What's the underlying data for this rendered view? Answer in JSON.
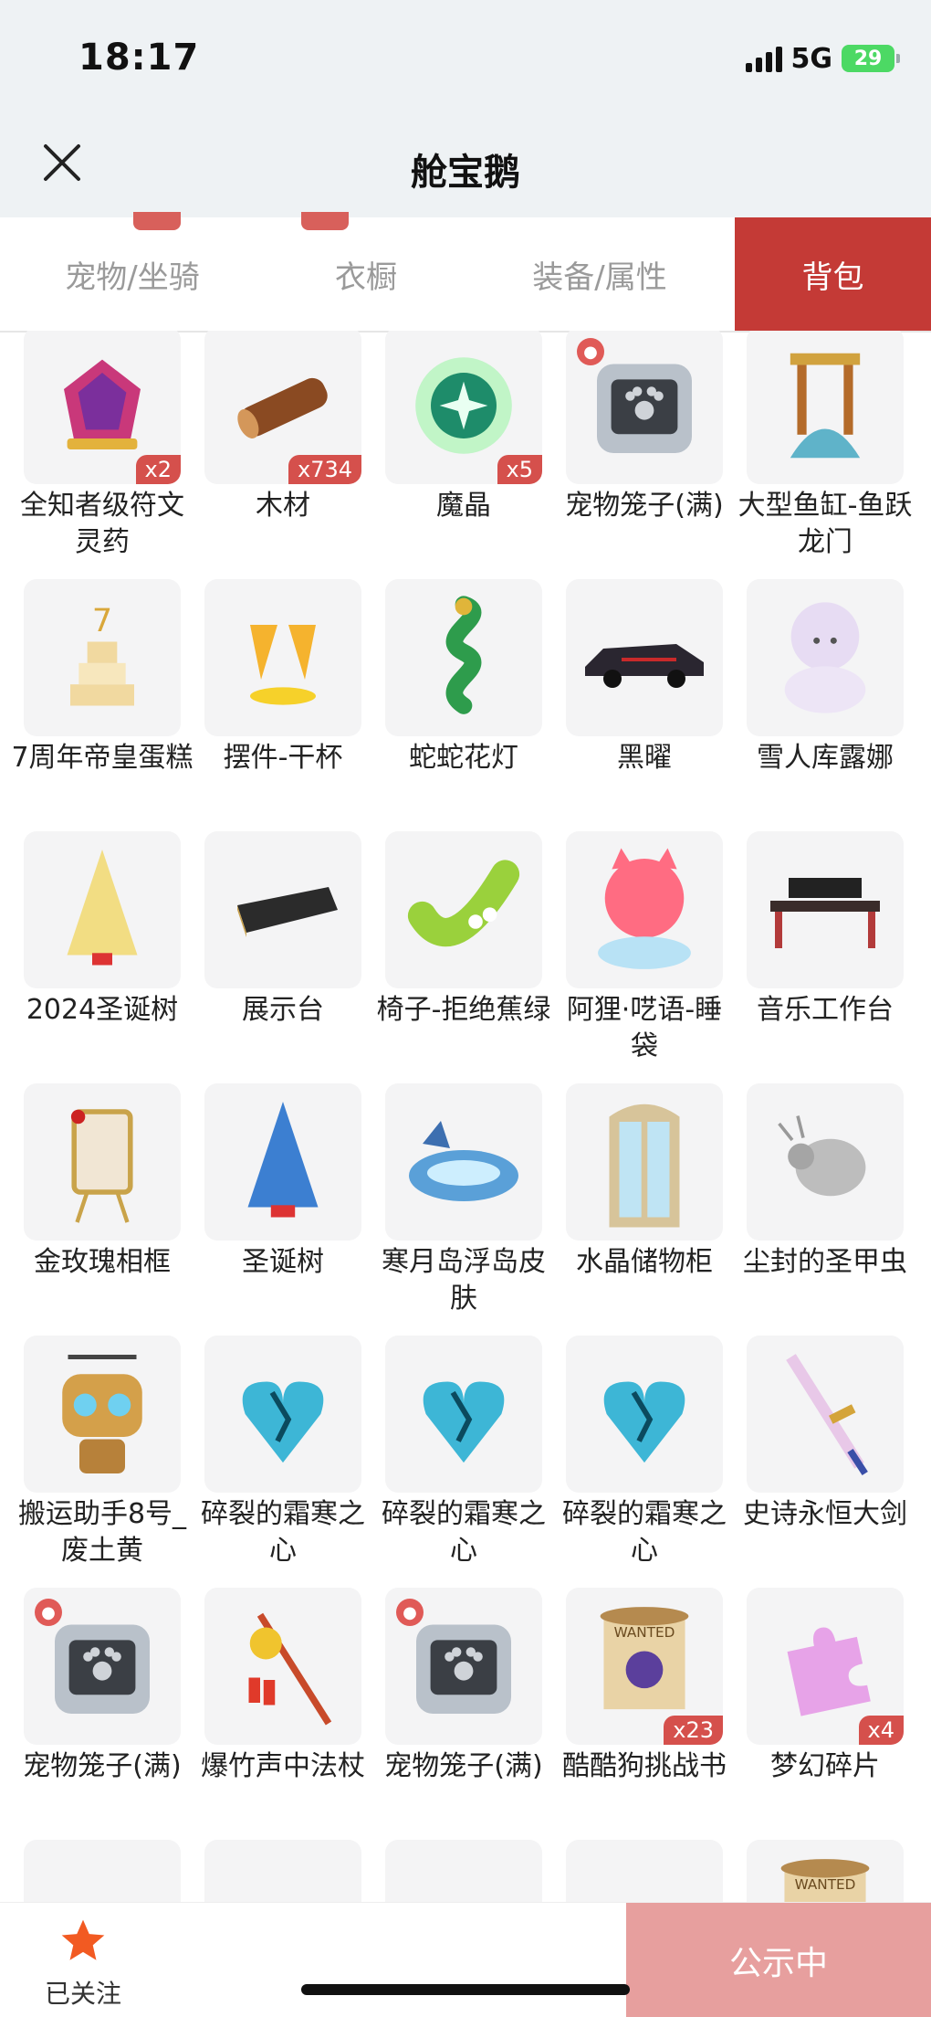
{
  "status": {
    "time": "18:17",
    "network": "5G",
    "battery": "29"
  },
  "header": {
    "title": "舱宝鹅"
  },
  "tabs": [
    {
      "label": "宠物/坐骑",
      "active": false
    },
    {
      "label": "衣橱",
      "active": false
    },
    {
      "label": "装备/属性",
      "active": false
    },
    {
      "label": "背包",
      "active": true
    }
  ],
  "items": [
    {
      "name": "全知者级符文灵药",
      "qty": "x2",
      "icon": "crystal-potion-icon"
    },
    {
      "name": "木材",
      "qty": "x734",
      "icon": "wood-log-icon"
    },
    {
      "name": "魔晶",
      "qty": "x5",
      "icon": "magic-crystal-icon"
    },
    {
      "name": "宠物笼子(满)",
      "qty": "",
      "icon": "pet-cage-icon"
    },
    {
      "name": "大型鱼缸-鱼跃龙门",
      "qty": "",
      "icon": "dragon-gate-icon"
    },
    {
      "name": "7周年帝皇蛋糕",
      "qty": "",
      "icon": "cake-icon"
    },
    {
      "name": "摆件-干杯",
      "qty": "",
      "icon": "cheers-icon"
    },
    {
      "name": "蛇蛇花灯",
      "qty": "",
      "icon": "snake-lantern-icon"
    },
    {
      "name": "黑曜",
      "qty": "",
      "icon": "car-icon"
    },
    {
      "name": "雪人库露娜",
      "qty": "",
      "icon": "snowman-icon"
    },
    {
      "name": "2024圣诞树",
      "qty": "",
      "icon": "gold-tree-icon"
    },
    {
      "name": "展示台",
      "qty": "",
      "icon": "display-stand-icon"
    },
    {
      "name": "椅子-拒绝蕉绿",
      "qty": "",
      "icon": "banana-chair-icon"
    },
    {
      "name": "阿狸·呓语-睡袋",
      "qty": "",
      "icon": "fox-sleeping-bag-icon"
    },
    {
      "name": "音乐工作台",
      "qty": "",
      "icon": "music-desk-icon"
    },
    {
      "name": "金玫瑰相框",
      "qty": "",
      "icon": "rose-frame-icon"
    },
    {
      "name": "圣诞树",
      "qty": "",
      "icon": "blue-tree-icon"
    },
    {
      "name": "寒月岛浮岛皮肤",
      "qty": "",
      "icon": "ice-island-icon"
    },
    {
      "name": "水晶储物柜",
      "qty": "",
      "icon": "crystal-cabinet-icon"
    },
    {
      "name": "尘封的圣甲虫",
      "qty": "",
      "icon": "scarab-icon"
    },
    {
      "name": "搬运助手8号_废土黄",
      "qty": "",
      "icon": "robot-icon"
    },
    {
      "name": "碎裂的霜寒之心",
      "qty": "",
      "icon": "frost-heart-icon"
    },
    {
      "name": "碎裂的霜寒之心",
      "qty": "",
      "icon": "frost-heart-icon"
    },
    {
      "name": "碎裂的霜寒之心",
      "qty": "",
      "icon": "frost-heart-icon"
    },
    {
      "name": "史诗永恒大剑",
      "qty": "",
      "icon": "sword-icon"
    },
    {
      "name": "宠物笼子(满)",
      "qty": "",
      "icon": "pet-cage-icon"
    },
    {
      "name": "爆竹声中法杖",
      "qty": "",
      "icon": "firecracker-staff-icon"
    },
    {
      "name": "宠物笼子(满)",
      "qty": "",
      "icon": "pet-cage-icon"
    },
    {
      "name": "酷酷狗挑战书",
      "qty": "x23",
      "icon": "wanted-scroll-icon"
    },
    {
      "name": "梦幻碎片",
      "qty": "x4",
      "icon": "puzzle-piece-icon"
    },
    {
      "name": "",
      "qty": "",
      "icon": "purple-item-icon"
    },
    {
      "name": "",
      "qty": "",
      "icon": "red-item-icon"
    },
    {
      "name": "",
      "qty": "",
      "icon": "gold-coin-icon"
    },
    {
      "name": "",
      "qty": "",
      "icon": "gold-coin-icon"
    },
    {
      "name": "",
      "qty": "",
      "icon": "wanted-scroll-icon"
    }
  ],
  "bottom": {
    "follow_label": "已关注",
    "public_label": "公示中"
  },
  "colors": {
    "accent": "#c43a36",
    "badge": "#d5504c",
    "public_button": "#e79f9e",
    "star": "#f25a22"
  }
}
